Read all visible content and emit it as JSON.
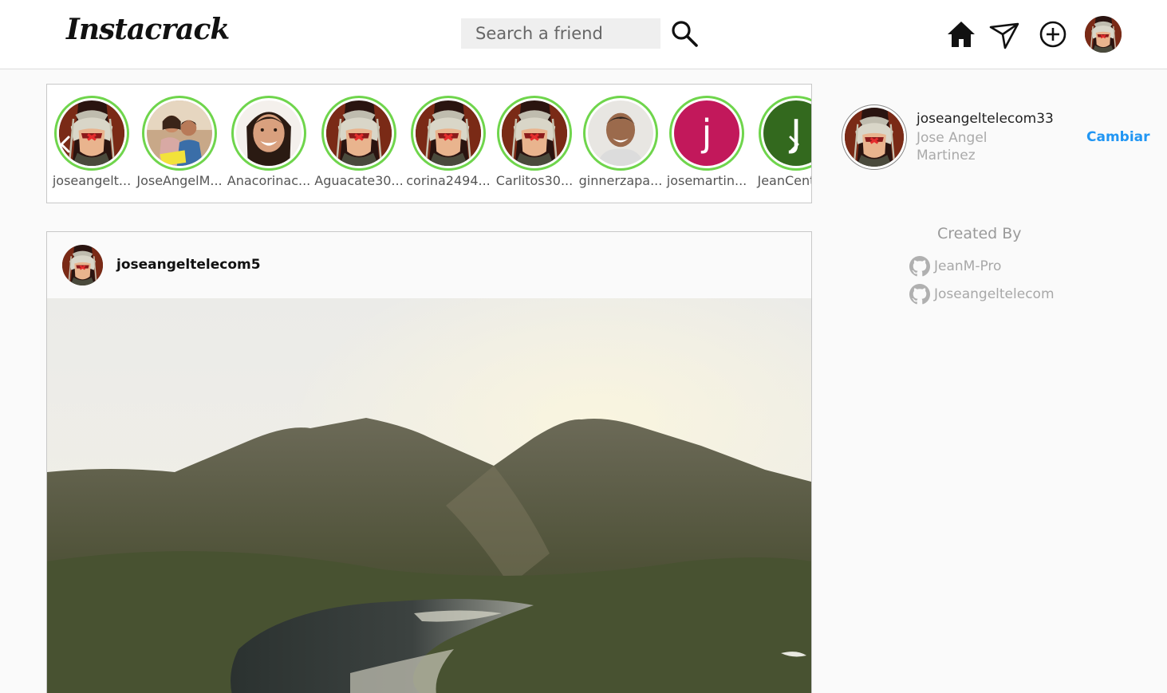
{
  "app": {
    "logo": "Instacrack"
  },
  "header": {
    "search_placeholder": "Search a friend",
    "icons": [
      "search-icon",
      "home-icon",
      "paper-plane-icon",
      "plus-circle-icon",
      "profile-avatar"
    ]
  },
  "stories": {
    "items": [
      {
        "label": "joseangelt...",
        "avatar": "anime"
      },
      {
        "label": "JoseAngelM...",
        "avatar": "couple-photo"
      },
      {
        "label": "Anacorinac...",
        "avatar": "woman-photo"
      },
      {
        "label": "Aguacate30...",
        "avatar": "anime"
      },
      {
        "label": "corina2494...",
        "avatar": "anime"
      },
      {
        "label": "Carlitos30...",
        "avatar": "anime"
      },
      {
        "label": "ginnerzapa...",
        "avatar": "man-photo"
      },
      {
        "label": "josemartin...",
        "avatar": "letter",
        "letter": "j",
        "color": "#c2185b"
      },
      {
        "label": "JeanCente...",
        "avatar": "letter",
        "letter": "J",
        "color": "#33691e"
      }
    ],
    "ring_color": "#6fd54c"
  },
  "post": {
    "username": "joseangeltelecom5",
    "image": "mountain-lake-landscape"
  },
  "sidebar": {
    "username": "joseangeltelecom33",
    "full_name": "Jose Angel Martinez",
    "switch_label": "Cambiar",
    "created_by_label": "Created By",
    "authors": [
      "JeanM-Pro",
      "Joseangeltelecom"
    ]
  },
  "colors": {
    "accent": "#2196f3",
    "story_ring": "#6fd54c",
    "border": "#c8c8c8"
  }
}
